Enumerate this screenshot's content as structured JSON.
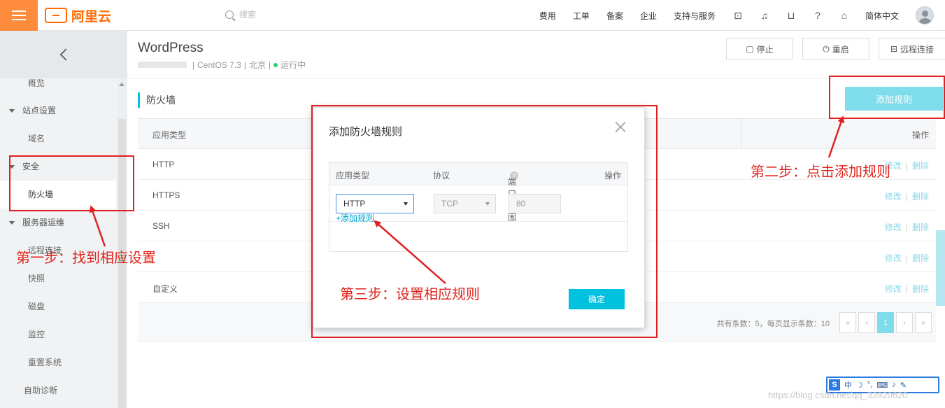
{
  "topbar": {
    "logo_text": "阿里云",
    "search_placeholder": "搜索",
    "nav": [
      "费用",
      "工单",
      "备案",
      "企业",
      "支持与服务"
    ],
    "language": "简体中文",
    "accent_color": "#ff8b3d",
    "icons": [
      "terminal-icon",
      "bell-icon",
      "cart-icon",
      "help-icon",
      "home-icon"
    ]
  },
  "sidebar": {
    "items": [
      {
        "label": "概览",
        "type": "sub"
      },
      {
        "label": "站点设置",
        "type": "group"
      },
      {
        "label": "域名",
        "type": "sub"
      },
      {
        "label": "安全",
        "type": "group"
      },
      {
        "label": "防火墙",
        "type": "sub",
        "active": true
      },
      {
        "label": "服务器运维",
        "type": "group"
      },
      {
        "label": "远程连接",
        "type": "sub"
      },
      {
        "label": "快照",
        "type": "sub"
      },
      {
        "label": "磁盘",
        "type": "sub"
      },
      {
        "label": "监控",
        "type": "sub"
      },
      {
        "label": "重置系统",
        "type": "sub"
      },
      {
        "label": "自助诊断",
        "type": "sub"
      }
    ]
  },
  "header": {
    "title": "WordPress",
    "os": "CentOS 7.3",
    "region": "北京",
    "status": "运行中",
    "buttons": {
      "stop": "停止",
      "restart": "重启",
      "remote": "远程连接"
    }
  },
  "section": {
    "title": "防火墙",
    "add_button": "添加规则"
  },
  "table": {
    "columns": [
      "应用类型",
      "操作"
    ],
    "rows": [
      "HTTP",
      "HTTPS",
      "SSH",
      "",
      "自定义"
    ],
    "op_edit": "修改",
    "op_delete": "删除",
    "footer_info": "共有条数：5，每页显示条数：10",
    "pager": [
      "«",
      "‹",
      "1",
      "›",
      "»"
    ]
  },
  "modal": {
    "title": "添加防火墙规则",
    "columns": [
      "应用类型",
      "协议",
      "端口范围",
      "操作"
    ],
    "app_type": "HTTP",
    "protocol": "TCP",
    "port": "80",
    "add_rule_link": "+添加规则",
    "confirm": "确定"
  },
  "annotations": {
    "step1": "第一步：找到相应设置",
    "step2": "第二步：点击添加规则",
    "step3": "第三步：设置相应规则"
  },
  "ime": {
    "lang": "中"
  },
  "watermark": "https://blog.csdn.net/qq_33920820"
}
